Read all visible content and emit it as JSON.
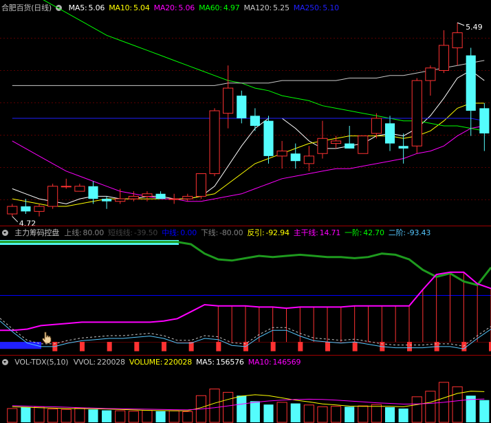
{
  "colors": {
    "up": "#ff3232",
    "down": "#54fcfc",
    "ma5": "#ffffff",
    "ma10": "#ffff00",
    "ma20": "#ff00ff",
    "ma60": "#00ff00",
    "ma120": "#c8c8c8",
    "ma250": "#0000ff",
    "green_line": "#1e9a1e",
    "magenta_line": "#ff00ff",
    "cyan_line": "#55c8ff",
    "blue_line": "#0000ff",
    "axis": "#a00000",
    "text": "#c0c0c0"
  },
  "price_pane": {
    "title": "合肥百货(日线)",
    "indicators": [
      {
        "label": "MA5:",
        "value": "5.06",
        "color": "#ffffff"
      },
      {
        "label": "MA10:",
        "value": "5.04",
        "color": "#ffff00"
      },
      {
        "label": "MA20:",
        "value": "5.06",
        "color": "#ff00ff"
      },
      {
        "label": "MA60:",
        "value": "4.97",
        "color": "#00ff00"
      },
      {
        "label": "MA120:",
        "value": "5.25",
        "color": "#c8c8c8"
      },
      {
        "label": "MA250:",
        "value": "5.10",
        "color": "#2020ff"
      }
    ],
    "high_label": "5.49",
    "low_label": "4.72"
  },
  "indicator_pane": {
    "title": "主力筹码控盘",
    "items": [
      {
        "label": "上线:",
        "value": "80.00",
        "color": "#808080"
      },
      {
        "label": "短线线:",
        "value": "-39.50",
        "color": "#404040"
      },
      {
        "label": "中线:",
        "value": "0.00",
        "color": "#0000ff"
      },
      {
        "label": "下线:",
        "value": "-80.00",
        "color": "#808080"
      },
      {
        "label": "反引:",
        "value": "-92.94",
        "color": "#ffff00"
      },
      {
        "label": "主干线:",
        "value": "14.71",
        "color": "#ff00ff"
      },
      {
        "label": "一阶:",
        "value": "42.70",
        "color": "#00ff00"
      },
      {
        "label": "二阶:",
        "value": "-93.43",
        "color": "#55c8ff"
      }
    ]
  },
  "volume_pane": {
    "title": "VOL-TDX(5,10)",
    "items": [
      {
        "label": "VVOL:",
        "value": "220028",
        "color": "#c0c0c0"
      },
      {
        "label": "VOLUME:",
        "value": "220028",
        "color": "#ffff00"
      },
      {
        "label": "MA5:",
        "value": "156576",
        "color": "#ffffff"
      },
      {
        "label": "MA10:",
        "value": "146569",
        "color": "#ff00ff"
      }
    ]
  },
  "chart_data": [
    {
      "type": "candlestick",
      "candles": [
        {
          "o": 4.73,
          "h": 4.77,
          "l": 4.72,
          "c": 4.76
        },
        {
          "o": 4.76,
          "h": 4.79,
          "l": 4.73,
          "c": 4.74
        },
        {
          "o": 4.74,
          "h": 4.77,
          "l": 4.72,
          "c": 4.76
        },
        {
          "o": 4.76,
          "h": 4.85,
          "l": 4.75,
          "c": 4.84
        },
        {
          "o": 4.84,
          "h": 4.87,
          "l": 4.83,
          "c": 4.84
        },
        {
          "o": 4.82,
          "h": 4.85,
          "l": 4.82,
          "c": 4.84
        },
        {
          "o": 4.84,
          "h": 4.86,
          "l": 4.77,
          "c": 4.79
        },
        {
          "o": 4.79,
          "h": 4.8,
          "l": 4.75,
          "c": 4.78
        },
        {
          "o": 4.78,
          "h": 4.83,
          "l": 4.77,
          "c": 4.79
        },
        {
          "o": 4.79,
          "h": 4.82,
          "l": 4.78,
          "c": 4.8
        },
        {
          "o": 4.8,
          "h": 4.82,
          "l": 4.78,
          "c": 4.81
        },
        {
          "o": 4.81,
          "h": 4.82,
          "l": 4.79,
          "c": 4.79
        },
        {
          "o": 4.79,
          "h": 4.81,
          "l": 4.77,
          "c": 4.79
        },
        {
          "o": 4.79,
          "h": 4.81,
          "l": 4.78,
          "c": 4.8
        },
        {
          "o": 4.8,
          "h": 4.89,
          "l": 4.79,
          "c": 4.89
        },
        {
          "o": 4.89,
          "h": 5.15,
          "l": 4.88,
          "c": 5.14
        },
        {
          "o": 5.13,
          "h": 5.32,
          "l": 5.07,
          "c": 5.23
        },
        {
          "o": 5.2,
          "h": 5.22,
          "l": 5.09,
          "c": 5.11
        },
        {
          "o": 5.12,
          "h": 5.15,
          "l": 5.06,
          "c": 5.08
        },
        {
          "o": 5.1,
          "h": 5.12,
          "l": 4.93,
          "c": 4.96
        },
        {
          "o": 4.96,
          "h": 5.02,
          "l": 4.91,
          "c": 4.98
        },
        {
          "o": 4.97,
          "h": 5.01,
          "l": 4.91,
          "c": 4.94
        },
        {
          "o": 4.93,
          "h": 5.0,
          "l": 4.9,
          "c": 4.96
        },
        {
          "o": 4.97,
          "h": 5.1,
          "l": 4.95,
          "c": 5.03
        },
        {
          "o": 5.01,
          "h": 5.04,
          "l": 4.99,
          "c": 5.02
        },
        {
          "o": 5.01,
          "h": 5.08,
          "l": 4.99,
          "c": 4.99
        },
        {
          "o": 4.97,
          "h": 5.03,
          "l": 4.97,
          "c": 5.04
        },
        {
          "o": 5.05,
          "h": 5.13,
          "l": 5.03,
          "c": 5.11
        },
        {
          "o": 5.09,
          "h": 5.12,
          "l": 4.98,
          "c": 5.01
        },
        {
          "o": 5.0,
          "h": 5.05,
          "l": 4.93,
          "c": 4.99
        },
        {
          "o": 5.0,
          "h": 5.27,
          "l": 4.97,
          "c": 5.26
        },
        {
          "o": 5.26,
          "h": 5.32,
          "l": 5.2,
          "c": 5.31
        },
        {
          "o": 5.3,
          "h": 5.46,
          "l": 5.29,
          "c": 5.4
        },
        {
          "o": 5.39,
          "h": 5.49,
          "l": 5.32,
          "c": 5.45
        },
        {
          "o": 5.36,
          "h": 5.39,
          "l": 5.04,
          "c": 5.14
        },
        {
          "o": 5.15,
          "h": 5.17,
          "l": 4.98,
          "c": 5.05
        }
      ],
      "ma": [
        {
          "name": "MA5",
          "color": "#ffffff",
          "values": [
            4.83,
            4.81,
            4.79,
            4.78,
            4.77,
            4.79,
            4.8,
            4.8,
            4.79,
            4.79,
            4.8,
            4.8,
            4.79,
            4.79,
            4.8,
            4.84,
            4.92,
            5.0,
            5.07,
            5.11,
            5.11,
            5.07,
            5.02,
            4.99,
            4.99,
            5.0,
            5.01,
            5.04,
            5.05,
            5.04,
            5.07,
            5.12,
            5.19,
            5.27,
            5.3,
            5.26
          ]
        },
        {
          "name": "MA10",
          "color": "#ffff00",
          "values": [
            4.79,
            4.78,
            4.77,
            4.76,
            4.76,
            4.77,
            4.78,
            4.79,
            4.79,
            4.79,
            4.79,
            4.79,
            4.79,
            4.79,
            4.8,
            4.81,
            4.85,
            4.89,
            4.93,
            4.95,
            4.97,
            4.99,
            5.01,
            5.02,
            5.03,
            5.04,
            5.04,
            5.04,
            5.04,
            5.03,
            5.04,
            5.06,
            5.1,
            5.15,
            5.17,
            5.17
          ]
        },
        {
          "name": "MA20",
          "color": "#ff00ff",
          "values": [
            5.02,
            4.99,
            4.96,
            4.93,
            4.9,
            4.88,
            4.86,
            4.84,
            4.82,
            4.81,
            4.8,
            4.79,
            4.79,
            4.78,
            4.78,
            4.79,
            4.8,
            4.81,
            4.83,
            4.85,
            4.87,
            4.88,
            4.89,
            4.9,
            4.91,
            4.91,
            4.92,
            4.93,
            4.94,
            4.95,
            4.97,
            4.98,
            5.0,
            5.04,
            5.07,
            5.08
          ]
        },
        {
          "name": "MA60",
          "color": "#00ff00",
          "values": [
            5.65,
            5.62,
            5.59,
            5.56,
            5.53,
            5.5,
            5.47,
            5.44,
            5.42,
            5.4,
            5.38,
            5.36,
            5.34,
            5.32,
            5.3,
            5.28,
            5.26,
            5.25,
            5.23,
            5.22,
            5.2,
            5.19,
            5.18,
            5.16,
            5.15,
            5.14,
            5.13,
            5.12,
            5.11,
            5.1,
            5.1,
            5.09,
            5.08,
            5.08,
            5.07,
            5.06
          ]
        },
        {
          "name": "MA120",
          "color": "#c8c8c8",
          "values": [
            5.24,
            5.24,
            5.24,
            5.24,
            5.24,
            5.24,
            5.24,
            5.24,
            5.24,
            5.24,
            5.24,
            5.24,
            5.24,
            5.24,
            5.24,
            5.24,
            5.25,
            5.25,
            5.25,
            5.25,
            5.26,
            5.26,
            5.26,
            5.26,
            5.26,
            5.27,
            5.27,
            5.27,
            5.28,
            5.28,
            5.29,
            5.3,
            5.31,
            5.32,
            5.33,
            5.34
          ]
        },
        {
          "name": "MA250",
          "color": "#2020ff",
          "values": [
            5.11,
            5.11,
            5.11,
            5.11,
            5.11,
            5.11,
            5.11,
            5.11,
            5.11,
            5.11,
            5.11,
            5.11,
            5.11,
            5.11,
            5.11,
            5.11,
            5.11,
            5.11,
            5.11,
            5.11,
            5.11,
            5.11,
            5.11,
            5.11,
            5.11,
            5.11,
            5.11,
            5.11,
            5.11,
            5.11,
            5.11,
            5.11,
            5.11,
            5.11,
            5.11,
            5.1
          ]
        }
      ],
      "ylim": [
        4.7,
        5.52
      ]
    },
    {
      "type": "line",
      "ylim": [
        -100,
        100
      ],
      "levels": [
        80,
        0,
        -80
      ],
      "green": [
        92,
        92,
        92,
        92,
        92,
        92,
        92,
        92,
        92,
        92,
        92,
        92,
        92,
        92,
        88,
        72,
        62,
        60,
        64,
        68,
        66,
        68,
        70,
        68,
        66,
        66,
        64,
        66,
        72,
        70,
        62,
        44,
        32,
        38,
        24,
        18,
        48
      ],
      "magenta": [
        -60,
        -60,
        -58,
        -52,
        -50,
        -48,
        -46,
        -46,
        -46,
        -46,
        -46,
        -46,
        -44,
        -40,
        -28,
        -16,
        -18,
        -18,
        -18,
        -20,
        -20,
        -22,
        -20,
        -20,
        -20,
        -20,
        -18,
        -18,
        -18,
        -18,
        -18,
        10,
        36,
        40,
        40,
        20,
        12
      ],
      "cyan": [
        -44,
        -64,
        -82,
        -88,
        -88,
        -82,
        -78,
        -76,
        -74,
        -74,
        -72,
        -70,
        -74,
        -82,
        -82,
        -74,
        -76,
        -86,
        -88,
        -72,
        -60,
        -60,
        -70,
        -78,
        -80,
        -82,
        -80,
        -84,
        -88,
        -90,
        -90,
        -90,
        -88,
        -88,
        -92,
        -74,
        -58
      ],
      "sticks_upper": [
        0,
        0,
        0,
        0,
        0,
        0,
        0,
        0,
        0,
        0,
        0,
        0,
        0,
        0,
        0,
        0,
        1,
        1,
        1,
        1,
        1,
        1,
        1,
        1,
        1,
        1,
        1,
        1,
        1,
        1,
        1,
        1,
        1,
        1,
        1,
        1,
        1
      ],
      "bars_lower": [
        1,
        1,
        1,
        1,
        1,
        1,
        1,
        1,
        1,
        1,
        1,
        1,
        1,
        1,
        1,
        1,
        1,
        1,
        1,
        1,
        1,
        1,
        1,
        1,
        1,
        1,
        1,
        1,
        1,
        1,
        1,
        1,
        1,
        1,
        1,
        1,
        1
      ]
    },
    {
      "type": "bar",
      "values": [
        62,
        68,
        70,
        60,
        58,
        64,
        58,
        54,
        52,
        50,
        54,
        50,
        52,
        48,
        120,
        150,
        135,
        120,
        95,
        80,
        90,
        85,
        78,
        70,
        72,
        70,
        74,
        80,
        68,
        62,
        115,
        140,
        180,
        160,
        120,
        100
      ],
      "ma5": [
        70,
        68,
        66,
        64,
        62,
        62,
        61,
        60,
        58,
        56,
        54,
        53,
        52,
        52,
        66,
        86,
        103,
        118,
        124,
        120,
        110,
        100,
        92,
        83,
        78,
        73,
        72,
        72,
        72,
        70,
        80,
        90,
        110,
        130,
        140,
        138
      ],
      "ma10": [
        75,
        73,
        71,
        70,
        68,
        66,
        64,
        62,
        61,
        60,
        59,
        58,
        57,
        56,
        60,
        66,
        74,
        82,
        90,
        96,
        100,
        103,
        104,
        103,
        100,
        96,
        92,
        88,
        85,
        82,
        83,
        85,
        90,
        97,
        103,
        105
      ],
      "ylim": [
        0,
        260
      ]
    }
  ]
}
